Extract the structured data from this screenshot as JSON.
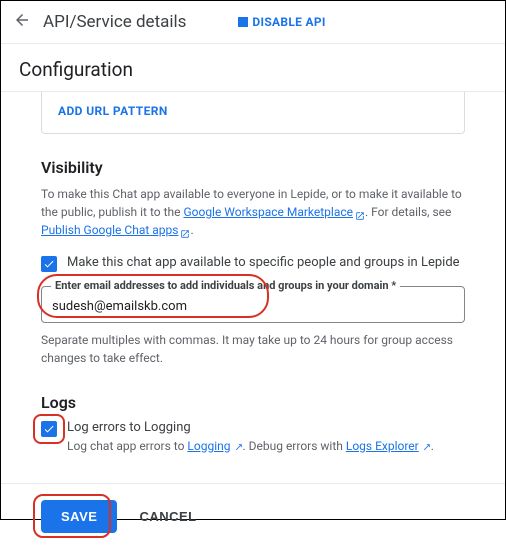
{
  "header": {
    "title": "API/Service details",
    "disable_api": "DISABLE API"
  },
  "config_title": "Configuration",
  "add_url_label": "ADD URL PATTERN",
  "visibility": {
    "heading": "Visibility",
    "desc_pre": "To make this Chat app available to everyone in Lepide, or to make it available to the public, publish it to the ",
    "link1": "Google Workspace Marketplace",
    "desc_mid": ". For details, see ",
    "link2": "Publish Google Chat apps",
    "desc_post": ".",
    "checkbox_label": "Make this chat app available to specific people and groups in Lepide",
    "email_floating_label": "Enter email addresses to add individuals and groups in your domain *",
    "email_value": "sudesh@emailskb.com",
    "help_text": "Separate multiples with commas. It may take up to 24 hours for group access changes to take effect."
  },
  "logs": {
    "heading": "Logs",
    "checkbox_label": "Log errors to Logging",
    "desc_pre": "Log chat app errors to ",
    "link1": "Logging",
    "desc_mid": ". Debug errors with ",
    "link2": "Logs Explorer",
    "desc_post": "."
  },
  "footer": {
    "save": "SAVE",
    "cancel": "CANCEL"
  }
}
